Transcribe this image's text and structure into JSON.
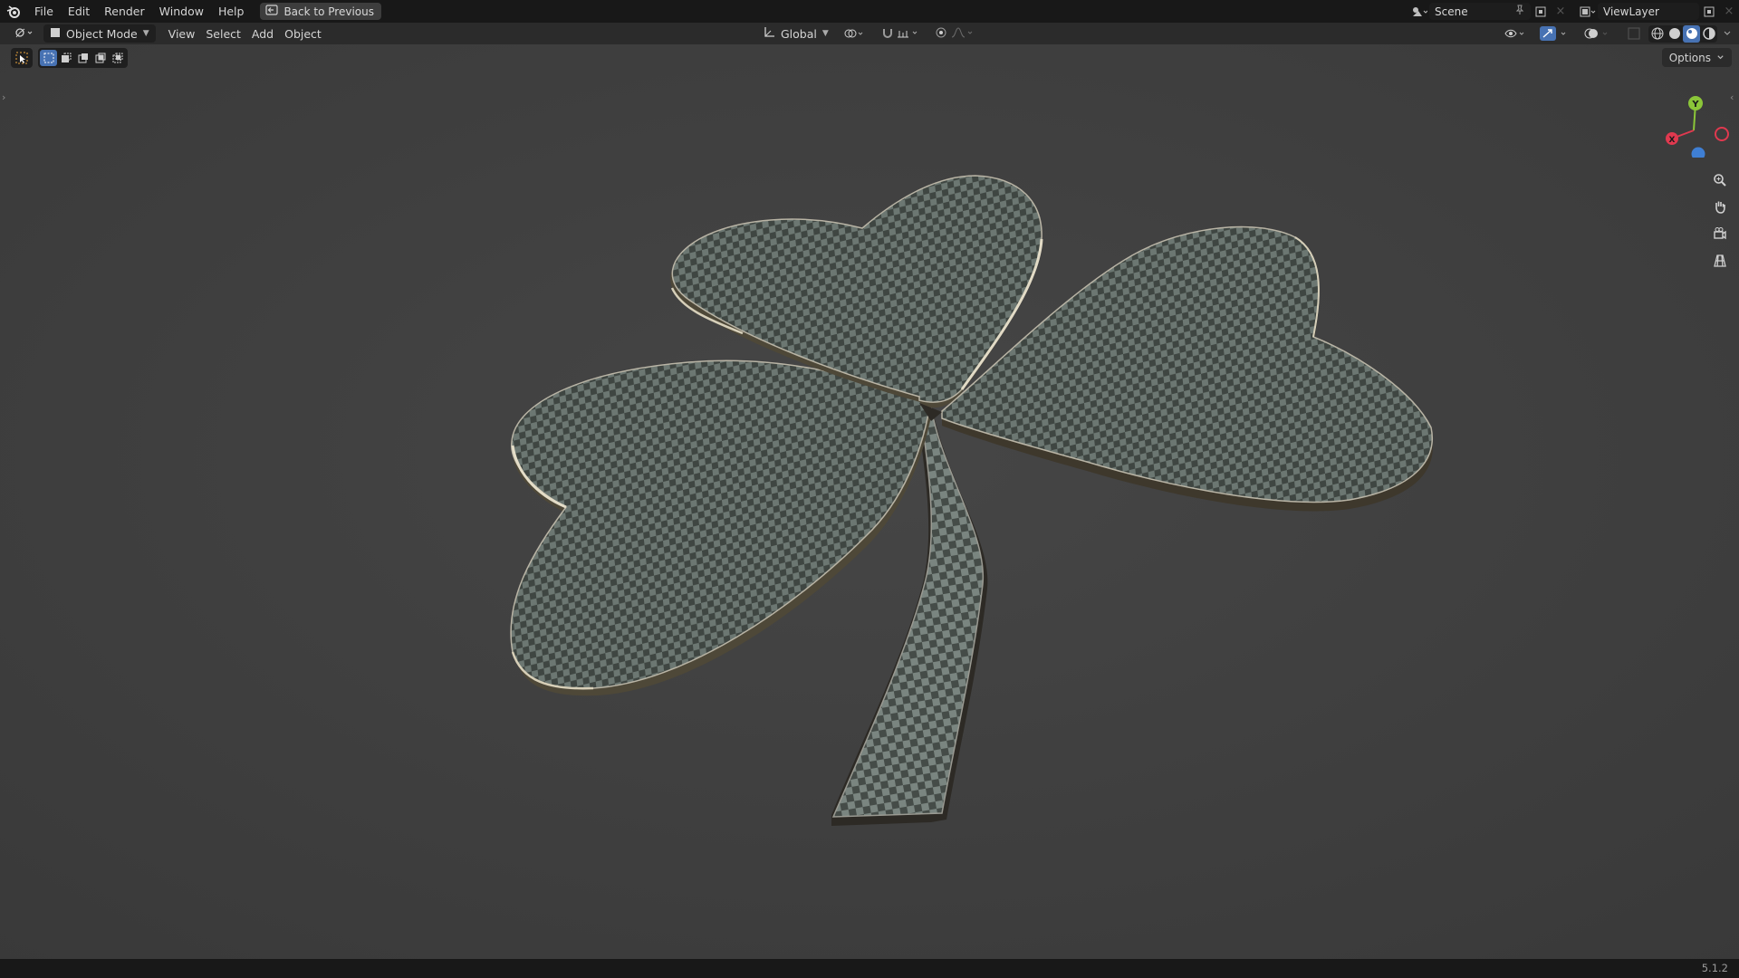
{
  "topbar": {
    "menus": [
      "File",
      "Edit",
      "Render",
      "Window",
      "Help"
    ],
    "back_button": "Back to Previous",
    "scene_name": "Scene",
    "view_layer_name": "ViewLayer"
  },
  "viewport_header": {
    "mode": "Object Mode",
    "menus": [
      "View",
      "Select",
      "Add",
      "Object"
    ],
    "transform_orientation": "Global",
    "options_label": "Options"
  },
  "gizmo": {
    "y_label": "Y",
    "x_label": "X"
  },
  "status": {
    "version": "5.1.2"
  },
  "colors": {
    "accent": "#4772b3",
    "axis_x": "#e0394f",
    "axis_y": "#8bc639",
    "axis_z": "#3f7fd4",
    "checker_dark": "#3f4642",
    "checker_light": "#6c7772"
  },
  "icons": [
    "blender-logo-icon",
    "back-icon",
    "editor-type-icon",
    "object-mode-icon",
    "transform-icon",
    "snap-icon",
    "proportional-icon",
    "zoom-icon",
    "pan-hand-icon",
    "camera-view-icon",
    "grid-view-icon"
  ]
}
